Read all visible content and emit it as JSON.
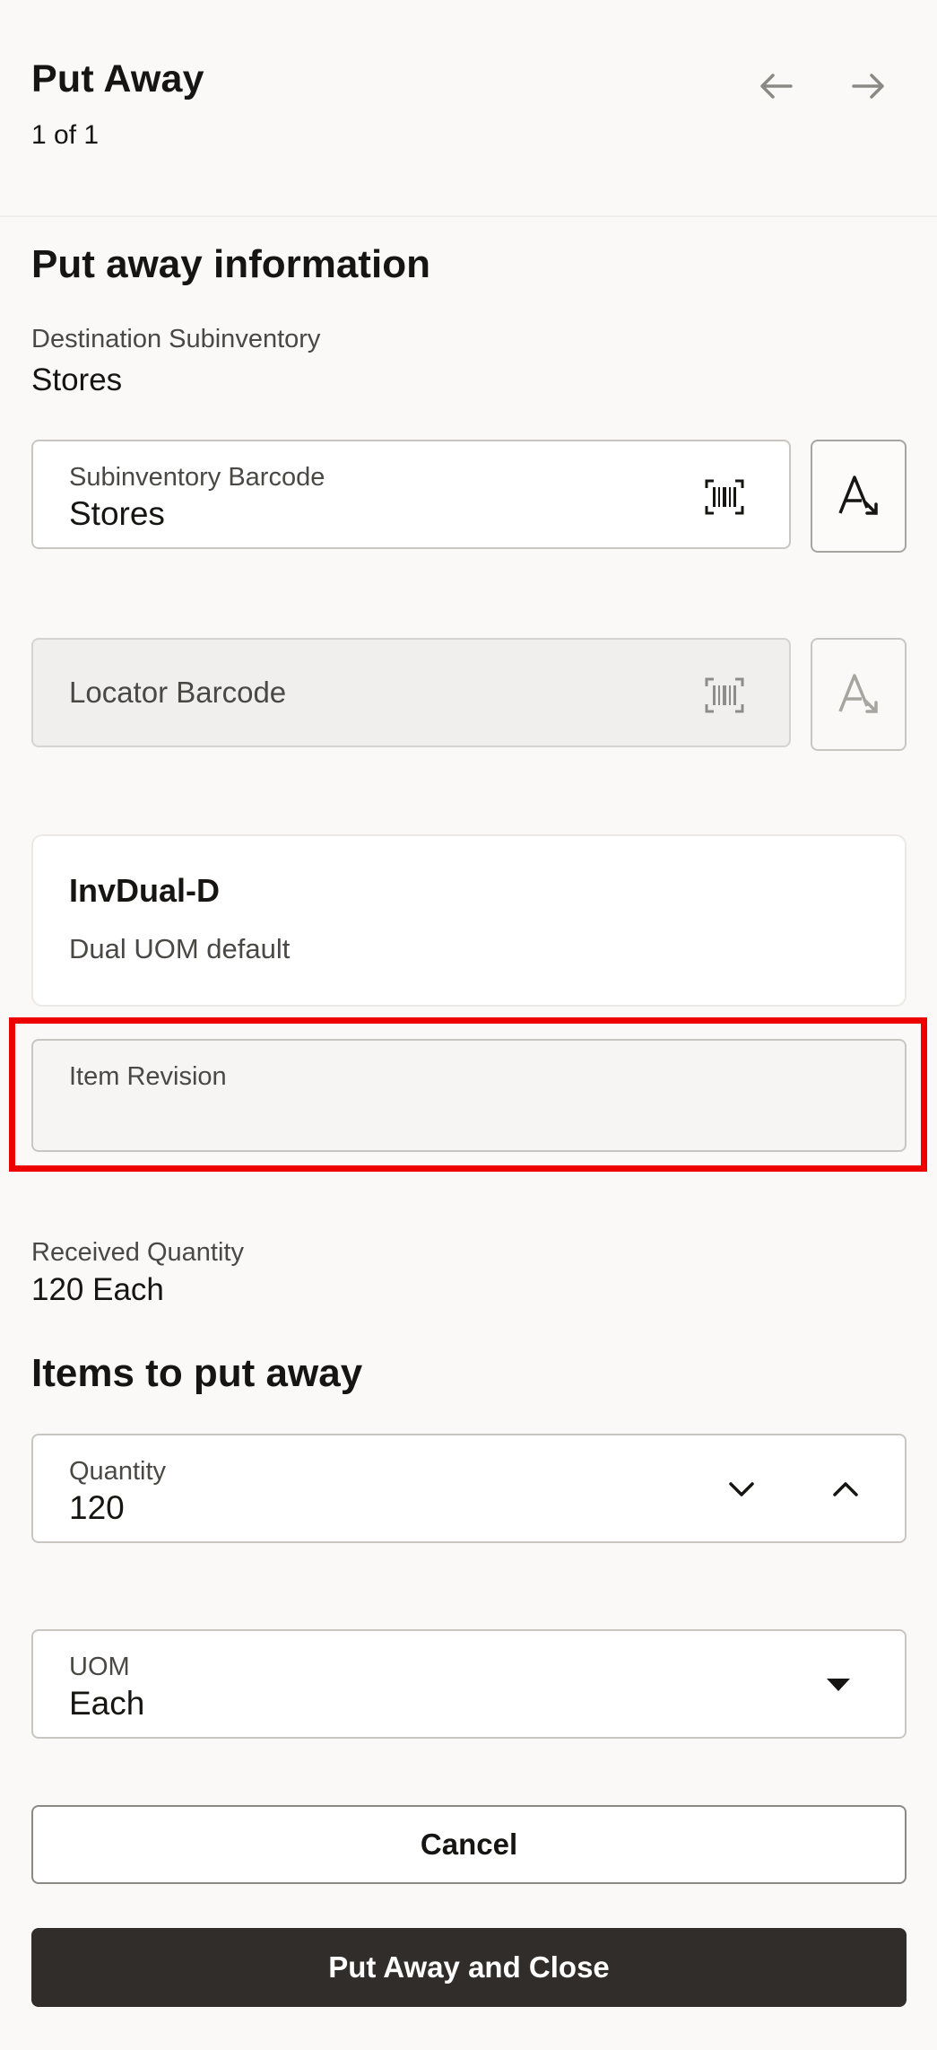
{
  "header": {
    "title": "Put Away",
    "page_count": "1 of 1",
    "prev_icon": "arrow-left-icon",
    "next_icon": "arrow-right-icon"
  },
  "putaway_info": {
    "section_title": "Put away information",
    "destination_label": "Destination Subinventory",
    "destination_value": "Stores",
    "subinventory_barcode": {
      "label": "Subinventory Barcode",
      "value": "Stores",
      "scan_icon": "barcode-scan-icon",
      "side_icon": "text-select-icon"
    },
    "locator_barcode": {
      "label": "Locator Barcode",
      "value": "",
      "disabled": true,
      "scan_icon": "barcode-scan-icon",
      "side_icon": "text-select-icon"
    },
    "item": {
      "name": "InvDual-D",
      "description": "Dual UOM default"
    },
    "item_revision": {
      "label": "Item Revision",
      "value": ""
    },
    "received_quantity_label": "Received Quantity",
    "received_quantity_value": "120 Each"
  },
  "items_to_put_away": {
    "section_title": "Items to put away",
    "quantity": {
      "label": "Quantity",
      "value": "120"
    },
    "uom": {
      "label": "UOM",
      "value": "Each"
    }
  },
  "footer": {
    "cancel_label": "Cancel",
    "primary_label": "Put Away and Close"
  },
  "colors": {
    "background": "#faf9f8",
    "primary_button": "#312d2a",
    "highlight": "#ee0000"
  }
}
